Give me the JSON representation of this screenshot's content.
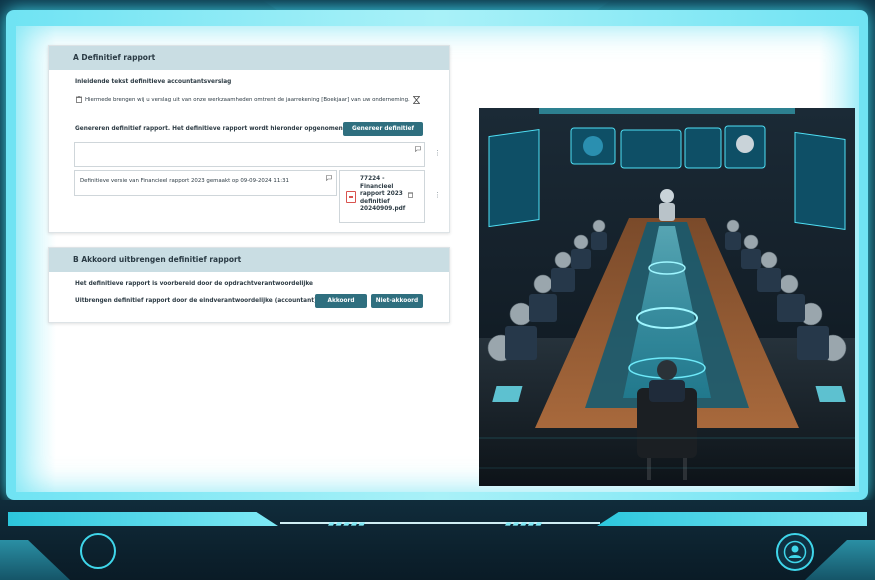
{
  "section_a": {
    "title": "A  Definitief rapport",
    "intro_label": "Inleidende tekst definitieve accountantsverslag",
    "intro_text": "Hiermede brengen wij u verslag uit van onze werkzaamheden omtrent de jaarrekening [Boekjaar] van uw onderneming.",
    "generate_label": "Genereren definitief rapport. Het definitieve rapport wordt hieronder opgenomen.",
    "generate_button": "Genereer definitief",
    "version_text": "Definitieve versie van Financieel rapport 2023 gemaakt op 09-09-2024 11:31",
    "file_lines": [
      "77224 -",
      "Financieel",
      "rapport 2023",
      "definitief",
      "20240909.pdf"
    ]
  },
  "section_b": {
    "title": "B  Akkoord uitbrengen definitief rapport",
    "prepared_label": "Het definitieve rapport is voorbereid door de opdrachtverantwoordelijke",
    "issue_label": "Uitbrengen definitief rapport door de eindverantwoordelijke (accountant)",
    "approve_button": "Akkoord",
    "reject_button": "Niet-akkoord"
  },
  "colors": {
    "accent": "#2f6f7f",
    "header_bg": "#c9dde3",
    "frame_glow": "#3fdcf0"
  }
}
